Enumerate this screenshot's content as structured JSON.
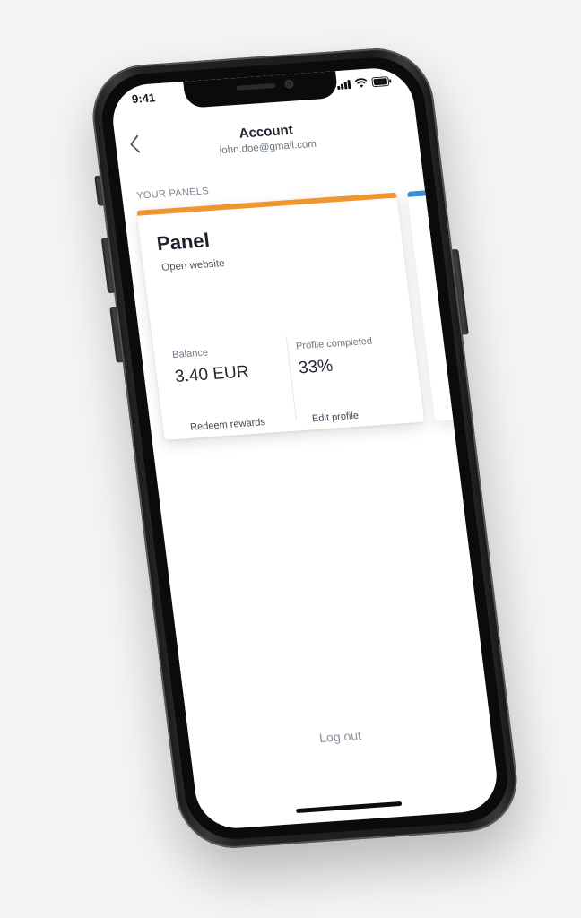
{
  "status_bar": {
    "time": "9:41",
    "icons": [
      "signal-icon",
      "wifi-icon",
      "battery-icon"
    ]
  },
  "header": {
    "back_icon": "chevron-left-icon",
    "title": "Account",
    "email": "john.doe@gmail.com"
  },
  "panels_section": {
    "label": "YOUR PANELS",
    "panels": [
      {
        "name": "Panel",
        "link_label": "Open website",
        "accent_color": "#f0962f",
        "balance_label": "Balance",
        "balance_value": "3.40 EUR",
        "redeem_label": "Redeem rewards",
        "profile_label": "Profile completed",
        "profile_value": "33%",
        "edit_label": "Edit profile"
      }
    ],
    "next_panel_accent_color": "#3a8ed8"
  },
  "footer": {
    "logout_label": "Log out"
  },
  "colors": {
    "background": "#f5f5f5",
    "screen": "#ffffff",
    "text_primary": "#1f2630",
    "text_secondary": "#6b7480"
  }
}
